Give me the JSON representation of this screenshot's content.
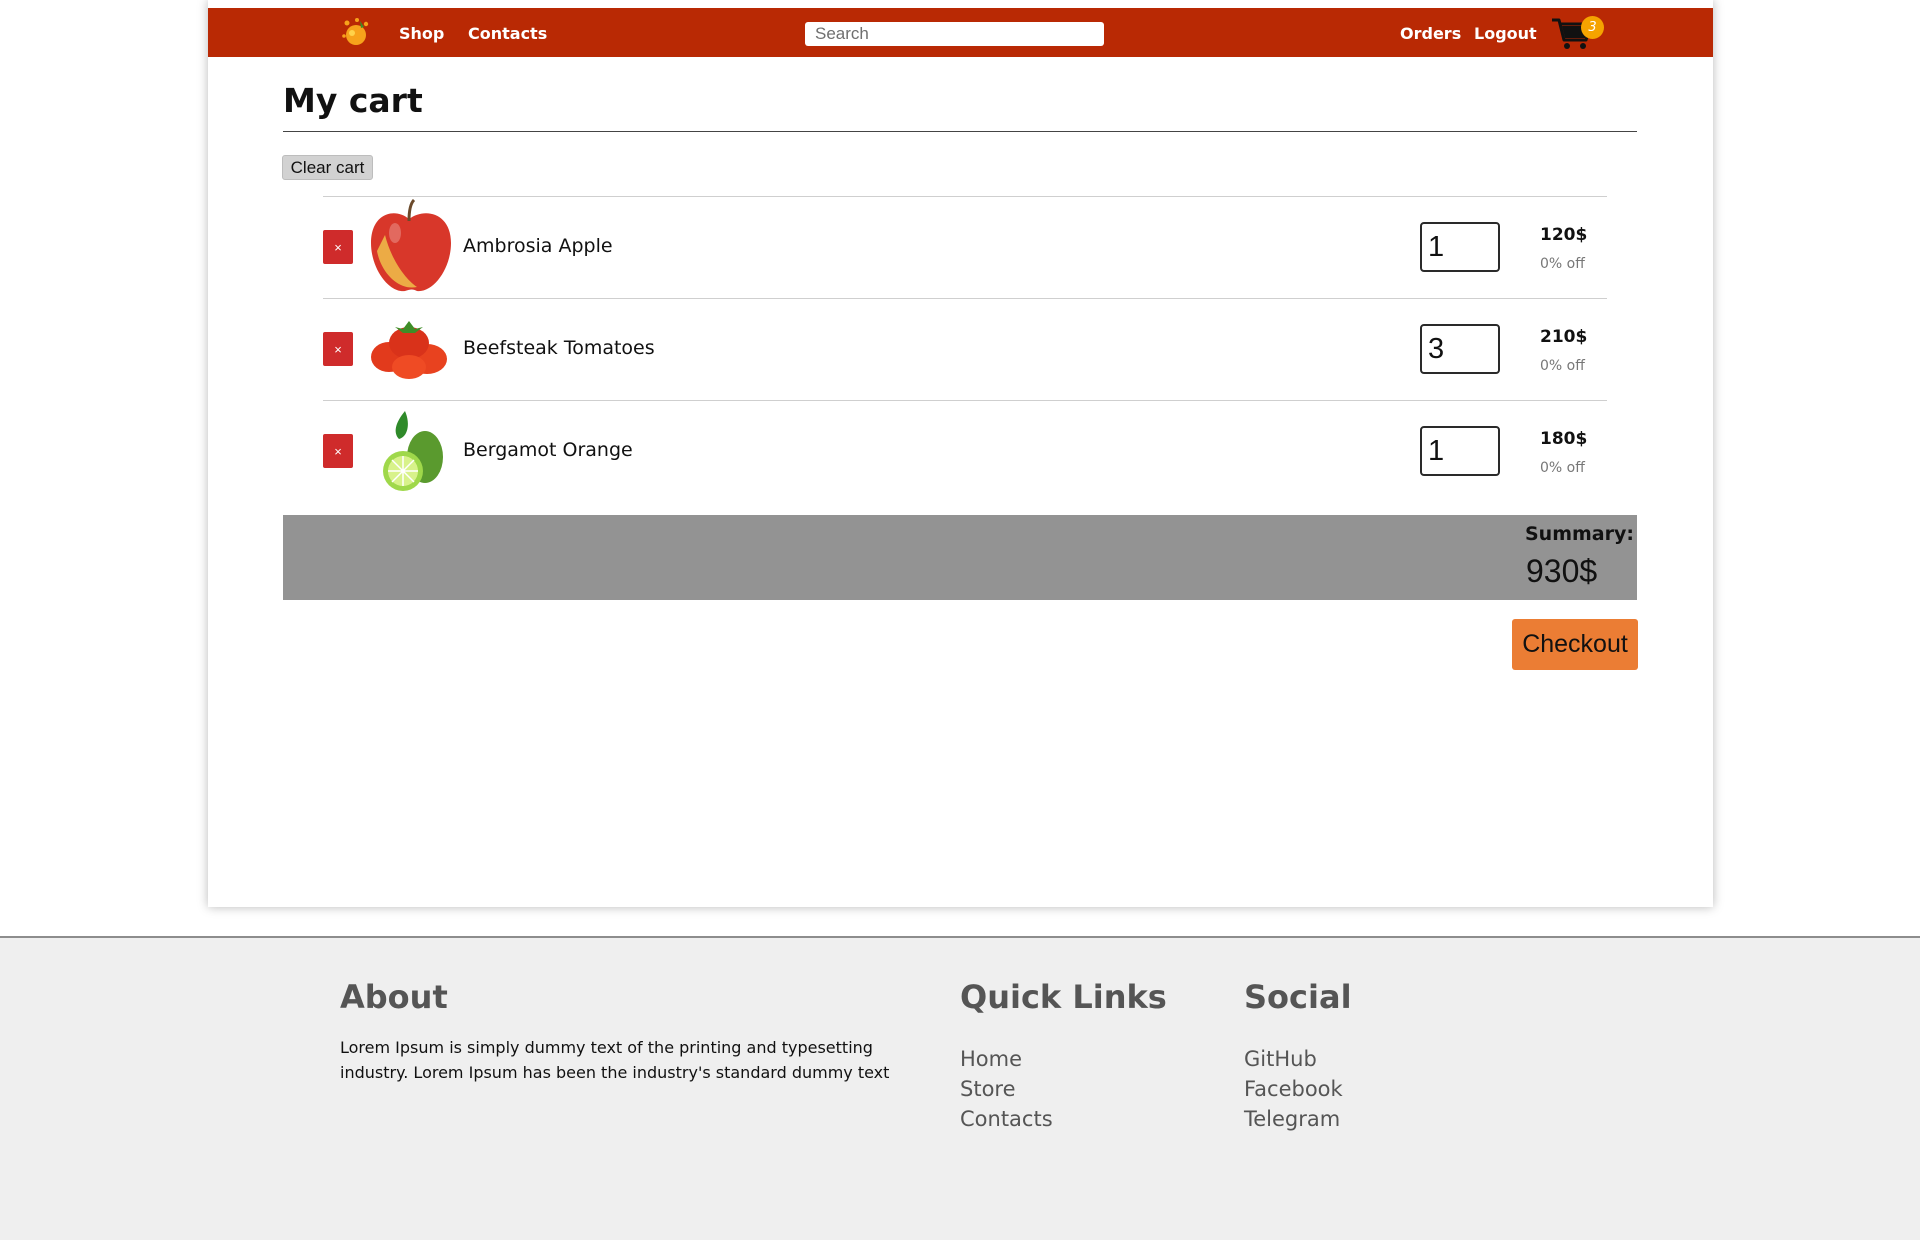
{
  "navbar": {
    "logo_icon": "orange-splash-logo-icon",
    "links": [
      "Shop",
      "Contacts"
    ],
    "search_placeholder": "Search",
    "right_links": [
      "Orders",
      "Logout"
    ],
    "cart_icon": "shopping-cart-icon",
    "cart_count": "3",
    "background_color": "#b92904"
  },
  "main": {
    "title": "My cart",
    "clear_cart_label": "Clear cart",
    "remove_glyph": "×",
    "items": [
      {
        "name": "Ambrosia Apple",
        "image_icon": "apple-product-image",
        "quantity": "1",
        "price": "120$",
        "discount": "0% off"
      },
      {
        "name": "Beefsteak Tomatoes",
        "image_icon": "tomatoes-product-image",
        "quantity": "3",
        "price": "210$",
        "discount": "0% off"
      },
      {
        "name": "Bergamot Orange",
        "image_icon": "bergamot-product-image",
        "quantity": "1",
        "price": "180$",
        "discount": "0% off"
      }
    ],
    "summary_label": "Summary:",
    "summary_total": "930$",
    "checkout_label": "Checkout",
    "checkout_color": "#eb7d34",
    "remove_color": "#cf2b2b"
  },
  "footer": {
    "about_title": "About",
    "about_text": "Lorem Ipsum is simply dummy text of the printing and typesetting industry. Lorem Ipsum has been the industry's standard dummy text",
    "quick_links_title": "Quick Links",
    "quick_links": [
      "Home",
      "Store",
      "Contacts"
    ],
    "social_title": "Social",
    "social_links": [
      "GitHub",
      "Facebook",
      "Telegram"
    ]
  }
}
